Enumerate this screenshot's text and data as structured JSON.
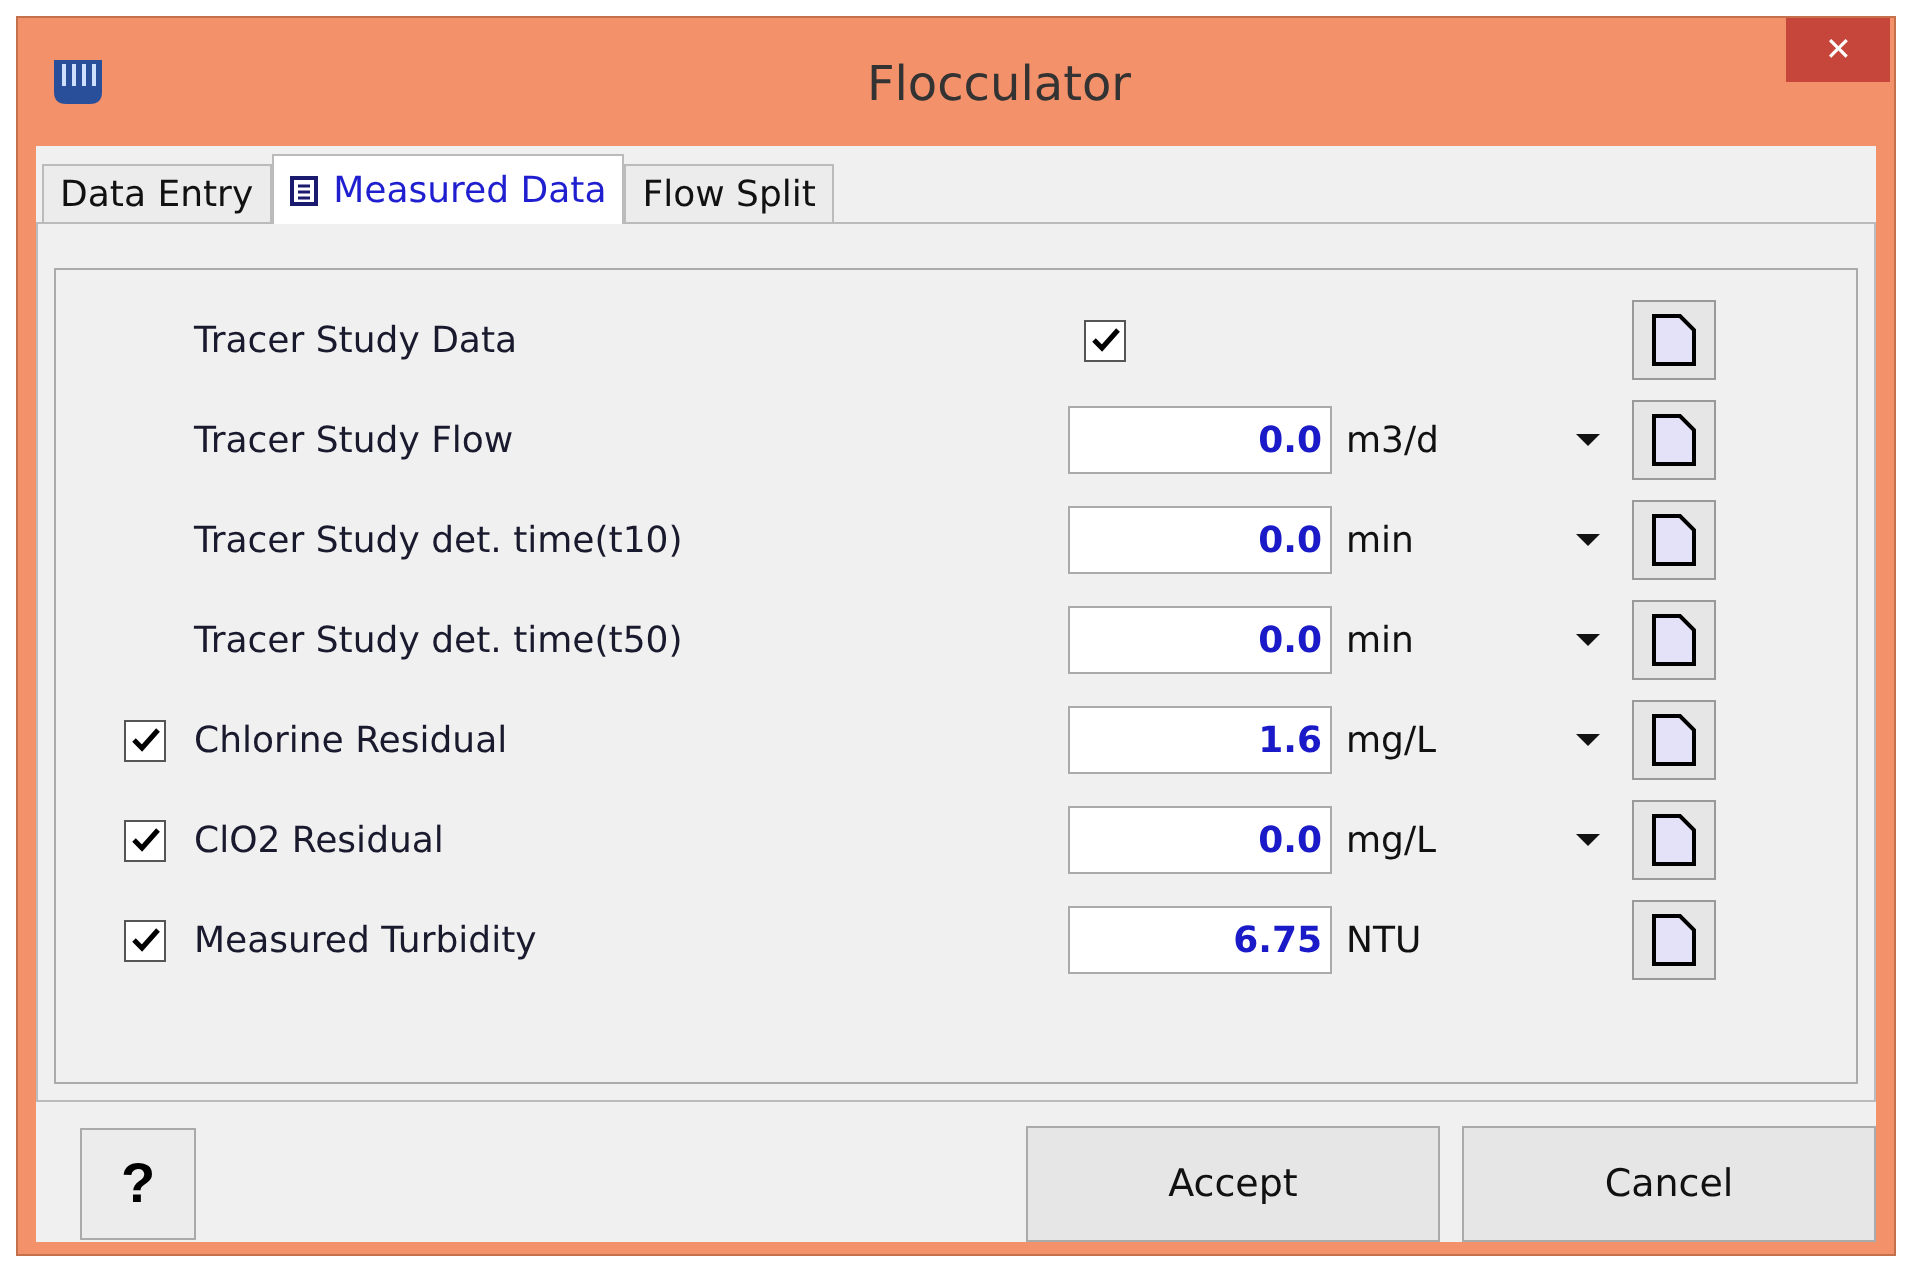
{
  "window": {
    "title": "Flocculator",
    "close": "✕"
  },
  "tabs": [
    {
      "label": "Data Entry",
      "selected": false,
      "icon": false
    },
    {
      "label": "Measured Data",
      "selected": true,
      "icon": true
    },
    {
      "label": "Flow Split",
      "selected": false,
      "icon": false
    }
  ],
  "rows": [
    {
      "kind": "checkbox",
      "label": "Tracer Study Data",
      "checked": true
    },
    {
      "kind": "field",
      "label": "Tracer Study Flow",
      "value": "0.0",
      "unit": "m3/d",
      "unit_menu": true
    },
    {
      "kind": "field",
      "label": "Tracer Study det. time(t10)",
      "value": "0.0",
      "unit": "min",
      "unit_menu": true
    },
    {
      "kind": "field",
      "label": "Tracer Study det. time(t50)",
      "value": "0.0",
      "unit": "min",
      "unit_menu": true
    },
    {
      "kind": "field",
      "label": "Chlorine Residual",
      "enabled": true,
      "value": "1.6",
      "unit": "mg/L",
      "unit_menu": true
    },
    {
      "kind": "field",
      "label": "ClO2 Residual",
      "enabled": true,
      "value": "0.0",
      "unit": "mg/L",
      "unit_menu": true
    },
    {
      "kind": "field",
      "label": "Measured Turbidity",
      "enabled": true,
      "value": "6.75",
      "unit": "NTU",
      "unit_menu": false
    }
  ],
  "help_button": "?",
  "buttons": [
    "Accept",
    "Cancel"
  ]
}
